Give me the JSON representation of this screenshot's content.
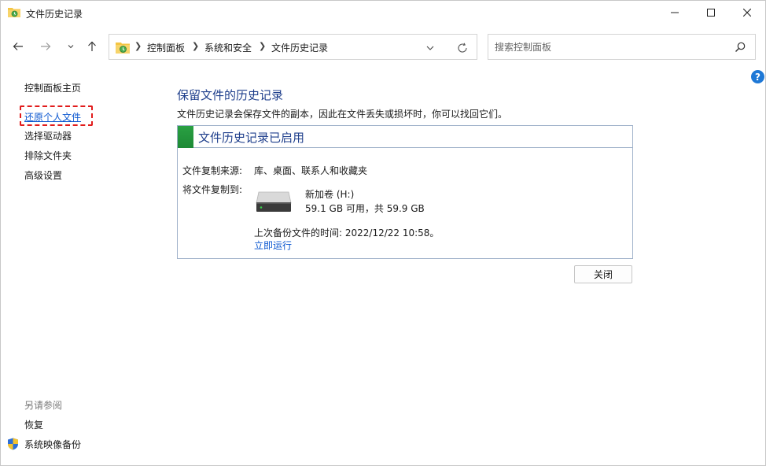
{
  "window": {
    "title": "文件历史记录",
    "icon": "file-history-folder-icon"
  },
  "controls": {
    "minimize": "minimize-icon",
    "maximize": "maximize-icon",
    "close": "close-icon"
  },
  "address": {
    "breadcrumb": [
      "控制面板",
      "系统和安全",
      "文件历史记录"
    ]
  },
  "search": {
    "placeholder": "搜索控制面板"
  },
  "sidebar": {
    "items": [
      {
        "label": "控制面板主页"
      },
      {
        "label": "还原个人文件"
      },
      {
        "label": "选择驱动器"
      },
      {
        "label": "排除文件夹"
      },
      {
        "label": "高级设置"
      }
    ],
    "see_also": {
      "heading": "另请参阅",
      "items": [
        {
          "label": "恢复"
        },
        {
          "label": "系统映像备份"
        }
      ]
    }
  },
  "main": {
    "heading": "保留文件的历史记录",
    "description": "文件历史记录会保存文件的副本，因此在文件丢失或损坏时，你可以找回它们。",
    "panel": {
      "status_title": "文件历史记录已启用",
      "status_color": "#1d8a35",
      "source_label": "文件复制来源:",
      "source_value": "库、桌面、联系人和收藏夹",
      "target_label": "将文件复制到:",
      "drive_name": "新加卷 (H:)",
      "drive_space": "59.1 GB 可用，共 59.9 GB",
      "last_backup": "上次备份文件的时间: 2022/12/22 10:58。",
      "run_now": "立即运行"
    },
    "close_button": "关闭"
  },
  "colors": {
    "link": "#0b57d0",
    "heading": "#1f3f8c",
    "highlight": "#e11c1c"
  }
}
